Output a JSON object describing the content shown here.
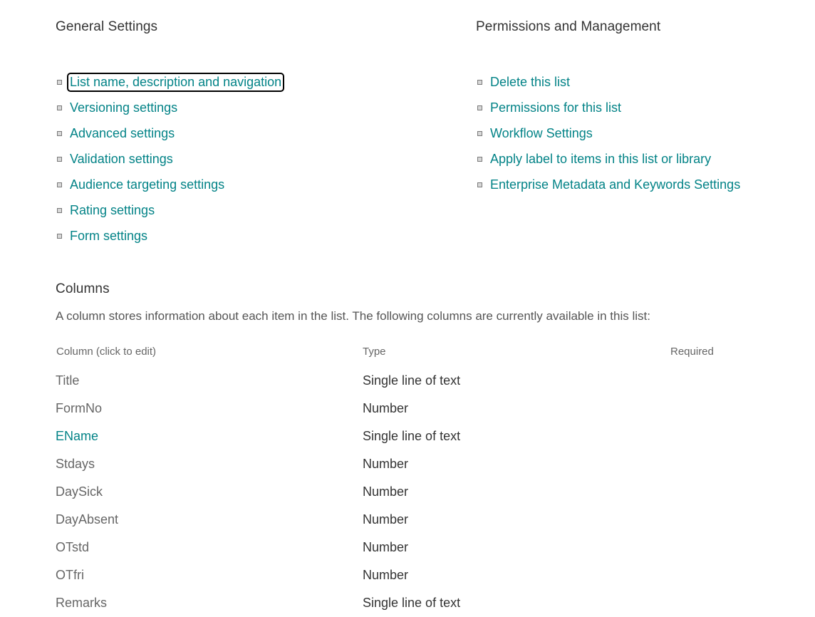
{
  "general_settings": {
    "title": "General Settings",
    "items": [
      {
        "label": "List name, description and navigation",
        "focused": true
      },
      {
        "label": "Versioning settings"
      },
      {
        "label": "Advanced settings"
      },
      {
        "label": "Validation settings"
      },
      {
        "label": "Audience targeting settings"
      },
      {
        "label": "Rating settings"
      },
      {
        "label": "Form settings"
      }
    ]
  },
  "permissions_management": {
    "title": "Permissions and Management",
    "items": [
      {
        "label": "Delete this list"
      },
      {
        "label": "Permissions for this list"
      },
      {
        "label": "Workflow Settings"
      },
      {
        "label": "Apply label to items in this list or library"
      },
      {
        "label": "Enterprise Metadata and Keywords Settings"
      }
    ]
  },
  "columns": {
    "title": "Columns",
    "description": "A column stores information about each item in the list. The following columns are currently available in this list:",
    "headers": {
      "column": "Column (click to edit)",
      "type": "Type",
      "required": "Required"
    },
    "rows": [
      {
        "name": "Title",
        "type": "Single line of text",
        "required": ""
      },
      {
        "name": "FormNo",
        "type": "Number",
        "required": ""
      },
      {
        "name": "EName",
        "type": "Single line of text",
        "required": "",
        "accent": true
      },
      {
        "name": "Stdays",
        "type": "Number",
        "required": ""
      },
      {
        "name": "DaySick",
        "type": "Number",
        "required": ""
      },
      {
        "name": "DayAbsent",
        "type": "Number",
        "required": ""
      },
      {
        "name": "OTstd",
        "type": "Number",
        "required": ""
      },
      {
        "name": "OTfri",
        "type": "Number",
        "required": ""
      },
      {
        "name": "Remarks",
        "type": "Single line of text",
        "required": ""
      }
    ]
  },
  "icons": {
    "bullet": "square-bullet-icon"
  },
  "colors": {
    "link": "#038387",
    "text": "#333333",
    "muted": "#666666",
    "focus_outline": "#000000"
  }
}
